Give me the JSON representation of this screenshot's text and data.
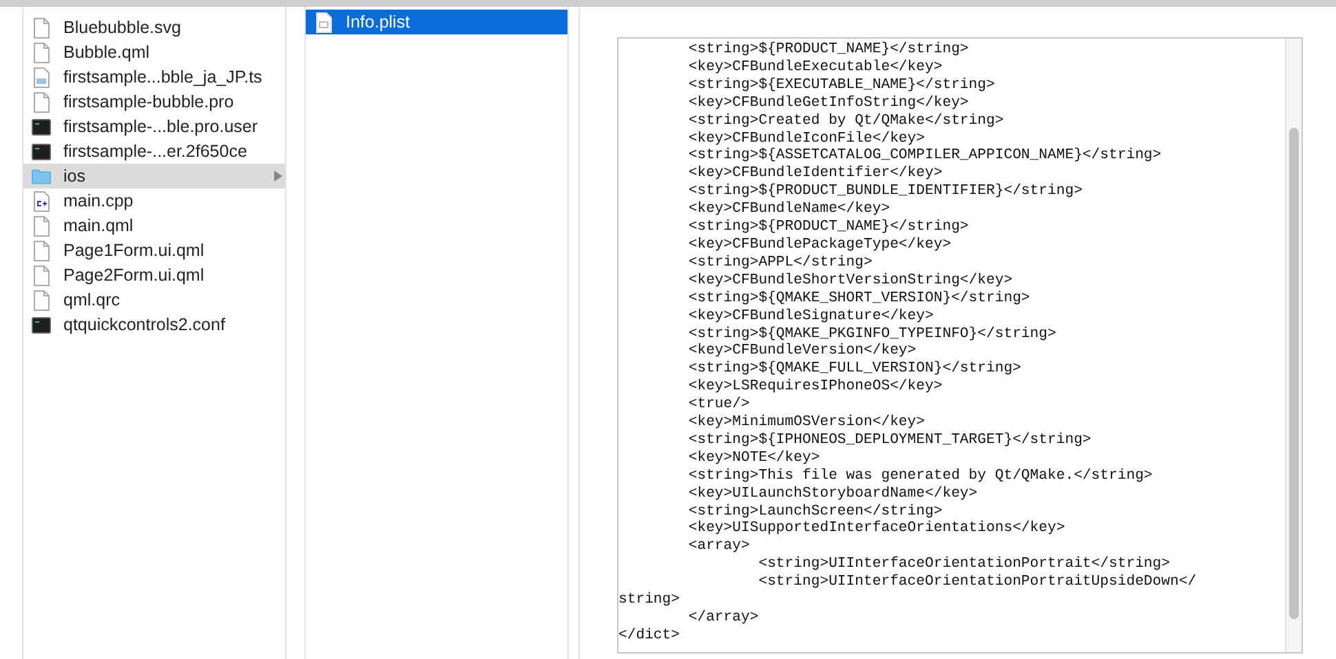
{
  "files": [
    {
      "name": "Bluebubble.svg",
      "kind": "blank",
      "selected": false
    },
    {
      "name": "Bubble.qml",
      "kind": "blank",
      "selected": false
    },
    {
      "name": "firstsample...bble_ja_JP.ts",
      "kind": "ts",
      "selected": false
    },
    {
      "name": "firstsample-bubble.pro",
      "kind": "blank",
      "selected": false
    },
    {
      "name": "firstsample-...ble.pro.user",
      "kind": "terminal",
      "selected": false
    },
    {
      "name": "firstsample-...er.2f650ce",
      "kind": "terminal",
      "selected": false
    },
    {
      "name": "ios",
      "kind": "folder",
      "selected": true
    },
    {
      "name": "main.cpp",
      "kind": "cpp",
      "selected": false
    },
    {
      "name": "main.qml",
      "kind": "blank",
      "selected": false
    },
    {
      "name": "Page1Form.ui.qml",
      "kind": "blank",
      "selected": false
    },
    {
      "name": "Page2Form.ui.qml",
      "kind": "blank",
      "selected": false
    },
    {
      "name": "qml.qrc",
      "kind": "blank",
      "selected": false
    },
    {
      "name": "qtquickcontrols2.conf",
      "kind": "terminal",
      "selected": false
    }
  ],
  "ios_files": [
    {
      "name": "Info.plist",
      "kind": "plist",
      "selected": true
    }
  ],
  "preview": {
    "lines": [
      "        <string>${PRODUCT_NAME}</string>",
      "        <key>CFBundleExecutable</key>",
      "        <string>${EXECUTABLE_NAME}</string>",
      "        <key>CFBundleGetInfoString</key>",
      "        <string>Created by Qt/QMake</string>",
      "        <key>CFBundleIconFile</key>",
      "        <string>${ASSETCATALOG_COMPILER_APPICON_NAME}</string>",
      "        <key>CFBundleIdentifier</key>",
      "        <string>${PRODUCT_BUNDLE_IDENTIFIER}</string>",
      "        <key>CFBundleName</key>",
      "        <string>${PRODUCT_NAME}</string>",
      "        <key>CFBundlePackageType</key>",
      "        <string>APPL</string>",
      "        <key>CFBundleShortVersionString</key>",
      "        <string>${QMAKE_SHORT_VERSION}</string>",
      "        <key>CFBundleSignature</key>",
      "        <string>${QMAKE_PKGINFO_TYPEINFO}</string>",
      "        <key>CFBundleVersion</key>",
      "        <string>${QMAKE_FULL_VERSION}</string>",
      "        <key>LSRequiresIPhoneOS</key>",
      "        <true/>",
      "        <key>MinimumOSVersion</key>",
      "        <string>${IPHONEOS_DEPLOYMENT_TARGET}</string>",
      "        <key>NOTE</key>",
      "        <string>This file was generated by Qt/QMake.</string>",
      "        <key>UILaunchStoryboardName</key>",
      "        <string>LaunchScreen</string>",
      "        <key>UISupportedInterfaceOrientations</key>",
      "        <array>",
      "                <string>UIInterfaceOrientationPortrait</string>",
      "                <string>UIInterfaceOrientationPortraitUpsideDown</",
      "string>",
      "        </array>",
      "</dict>"
    ]
  }
}
